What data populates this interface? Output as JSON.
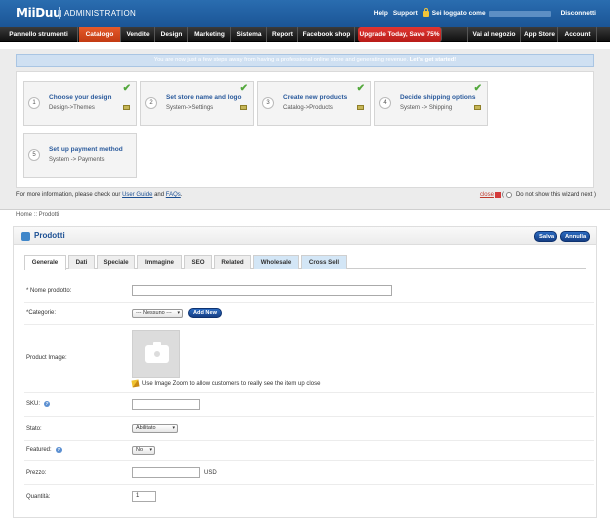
{
  "header": {
    "logo": "MiiDuu",
    "title": "ADMINISTRATION",
    "help": "Help",
    "support": "Support",
    "logged_as": "Sei loggato come",
    "logout": "Disconnetti"
  },
  "nav": {
    "items": [
      "Pannello strumenti",
      "Catalogo",
      "Vendite",
      "Design",
      "Marketing",
      "Sistema",
      "Report",
      "Facebook shop",
      "Upgrade Today, Save 75%",
      "Vai al negozio",
      "App Store",
      "Account"
    ]
  },
  "wizard": {
    "banner_text": "You are now just a few steps away from having a professional online store and generating revenue.",
    "banner_strong": "Let's get started!",
    "steps": [
      {
        "num": "1",
        "title": "Choose your design",
        "sub": "Design->Themes"
      },
      {
        "num": "2",
        "title": "Set store name and logo",
        "sub": "System->Settings"
      },
      {
        "num": "3",
        "title": "Create new products",
        "sub": "Catalog->Products"
      },
      {
        "num": "4",
        "title": "Decide shipping options",
        "sub": "System -> Shipping"
      },
      {
        "num": "5",
        "title": "Set up payment method",
        "sub": "System -> Payments"
      }
    ],
    "more_info_prefix": "For more information, please check our",
    "user_guide": "User Guide",
    "and": "and",
    "faqs": "FAQs",
    "period": ".",
    "close": "close",
    "open_paren": "(",
    "dont_show": "Do not show this wizard next )"
  },
  "breadcrumb": "Home :: Prodotti",
  "panel": {
    "title": "Prodotti",
    "save": "Salva",
    "cancel": "Annulla",
    "tabs": [
      "Generale",
      "Dati",
      "Speciale",
      "Immagine",
      "SEO",
      "Related",
      "Wholesale",
      "Cross Sell"
    ]
  },
  "form": {
    "name_label": "* Nome prodotto:",
    "category_label": "*Categorie:",
    "category_value": "--- Nessuno ---",
    "add_new": "Add New",
    "image_label": "Product Image:",
    "zoom_note": "Use Image Zoom to allow customers to really see the item up close",
    "sku_label": "SKU:",
    "status_label": "Stato:",
    "status_value": "Abilitato",
    "featured_label": "Featured:",
    "featured_value": "No",
    "price_label": "Prezzo:",
    "price_unit": "USD",
    "qty_label": "Quantità:",
    "qty_value": "1",
    "help_glyph": "?"
  },
  "colors": {
    "header_blue": "#1b5596",
    "nav_active": "#d4461b",
    "promo_red": "#c8201c",
    "link_blue": "#1b4f93"
  }
}
